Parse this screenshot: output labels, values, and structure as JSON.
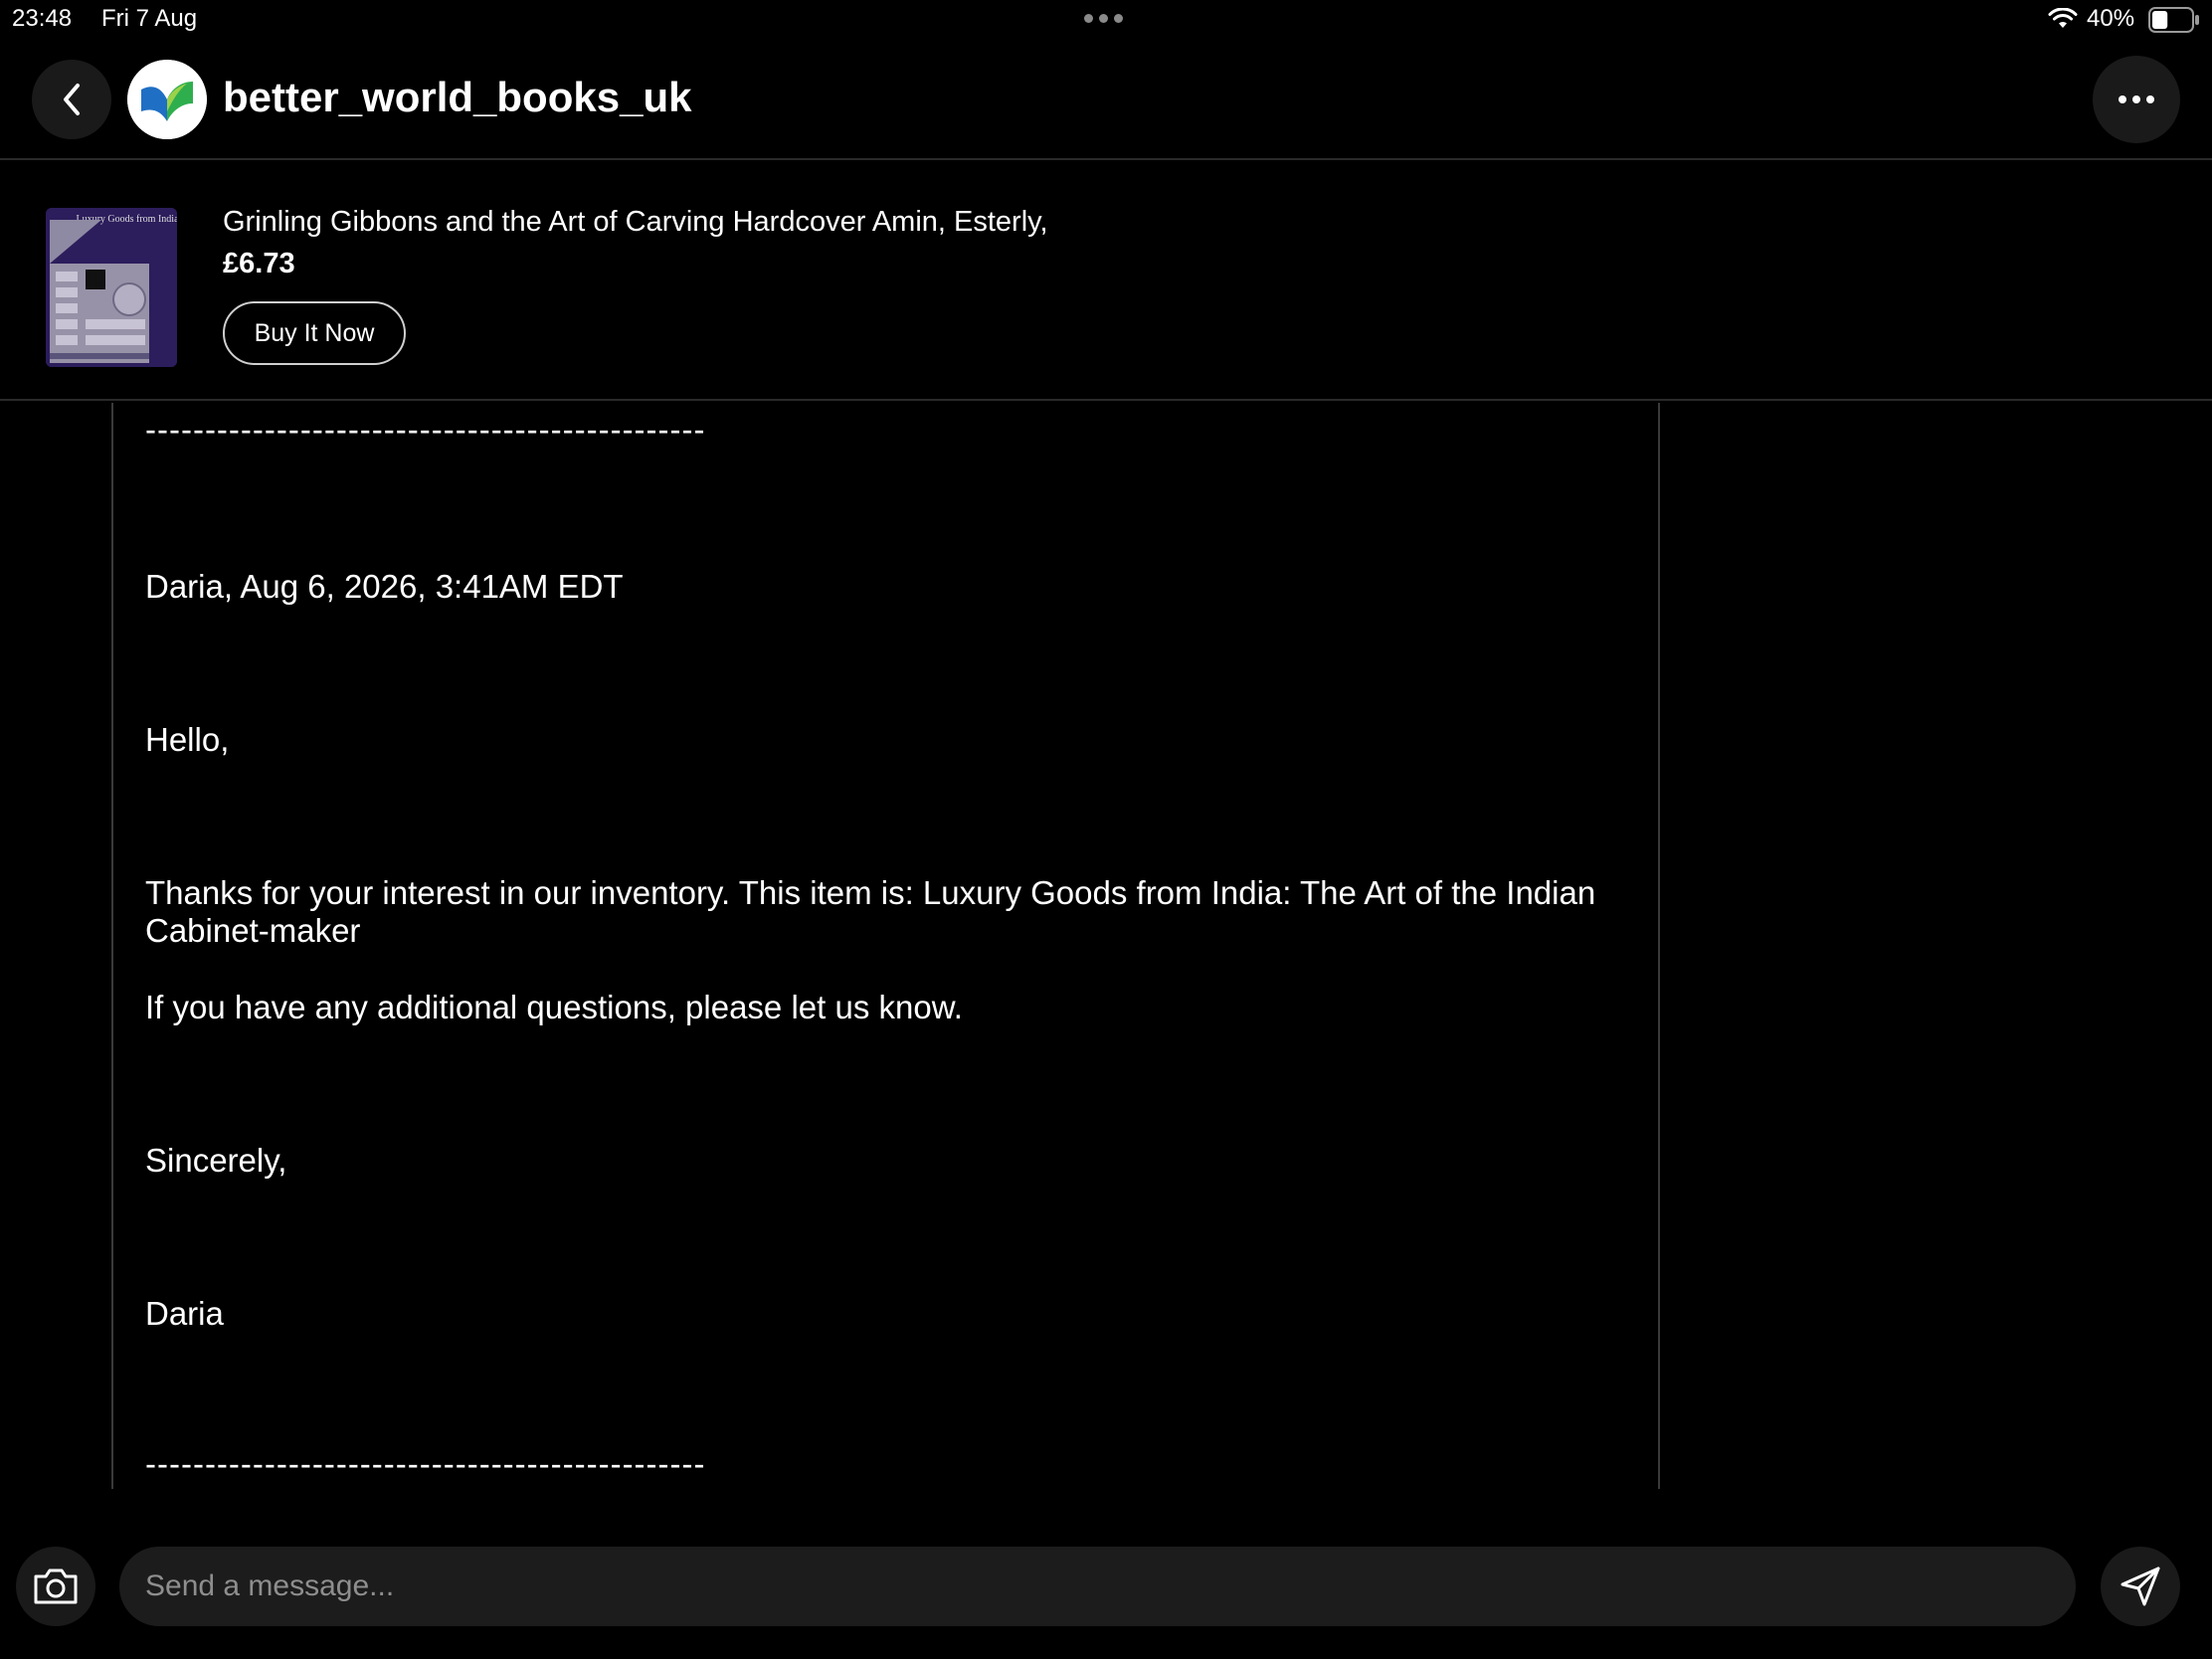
{
  "status_bar": {
    "time": "23:48",
    "date": "Fri 7 Aug",
    "battery_percent": "40%",
    "battery_level": 0.4
  },
  "header": {
    "username": "better_world_books_uk"
  },
  "item": {
    "title": "Grinling Gibbons and the Art of Carving Hardcover Amin, Esterly,",
    "price": "£6.73",
    "buy_label": "Buy It Now",
    "thumbnail_cover_text": "Luxury Goods from India"
  },
  "message": {
    "divider_top": "-----------------------------------------------",
    "sender_line": "Daria, Aug 6, 2026, 3:41AM EDT",
    "greeting": "Hello,",
    "body_line_1": "Thanks for your interest in our inventory. This item is: Luxury Goods from India: The Art of the Indian",
    "body_line_2": "Cabinet-maker",
    "body_line_3": "If you have any additional questions, please let us know.",
    "closing": "Sincerely,",
    "signature": "Daria",
    "divider_bottom": "-----------------------------------------------"
  },
  "composer": {
    "placeholder": "Send a message..."
  },
  "colors": {
    "background": "#000000",
    "surface": "#1a1a1a",
    "divider": "#2a2a2a",
    "text": "#ffffff",
    "placeholder": "#8e8e8e"
  }
}
